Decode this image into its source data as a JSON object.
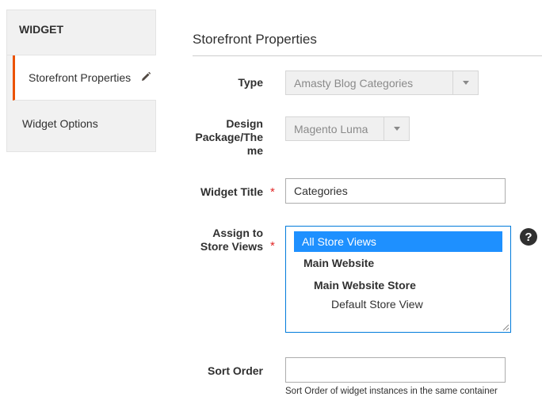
{
  "sidebar": {
    "title": "WIDGET",
    "items": [
      {
        "label": "Storefront Properties",
        "active": true,
        "icon": "pencil-icon"
      },
      {
        "label": "Widget Options",
        "active": false
      }
    ]
  },
  "main": {
    "section_title": "Storefront Properties",
    "fields": {
      "type": {
        "label": "Type",
        "value": "Amasty Blog Categories"
      },
      "design": {
        "label_line1": "Design",
        "label_line2": "Package/The",
        "label_line3": "me",
        "value": "Magento Luma"
      },
      "title": {
        "label": "Widget Title",
        "required_mark": "*",
        "value": "Categories"
      },
      "store_views": {
        "label_line1": "Assign to",
        "label_line2": "Store Views",
        "required_mark": "*",
        "options": {
          "all": "All Store Views",
          "website": "Main Website",
          "store": "Main Website Store",
          "view": "Default Store View"
        },
        "help_glyph": "?"
      },
      "sort_order": {
        "label": "Sort Order",
        "value": "",
        "note": "Sort Order of widget instances in the same container"
      }
    }
  },
  "colors": {
    "accent": "#eb5202",
    "selected": "#1e90ff",
    "focus_border": "#007bdb",
    "required": "#e22626"
  }
}
